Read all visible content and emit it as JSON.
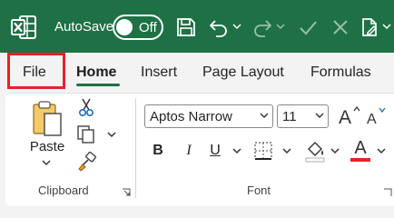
{
  "titlebar": {
    "autosave_label": "AutoSave",
    "autosave_state": "Off",
    "background": "#1e7145"
  },
  "tabs": [
    {
      "label": "File",
      "selected": false,
      "highlighted": true
    },
    {
      "label": "Home",
      "selected": true
    },
    {
      "label": "Insert",
      "selected": false
    },
    {
      "label": "Page Layout",
      "selected": false
    },
    {
      "label": "Formulas",
      "selected": false
    }
  ],
  "clipboard": {
    "paste_label": "Paste",
    "group_label": "Clipboard"
  },
  "font": {
    "family": "Aptos Narrow",
    "size": "11",
    "bold": "B",
    "italic": "I",
    "underline": "U",
    "font_color_letter": "A",
    "font_color": "#e8202a",
    "group_label": "Font"
  },
  "highlight_color": "#e8202a"
}
